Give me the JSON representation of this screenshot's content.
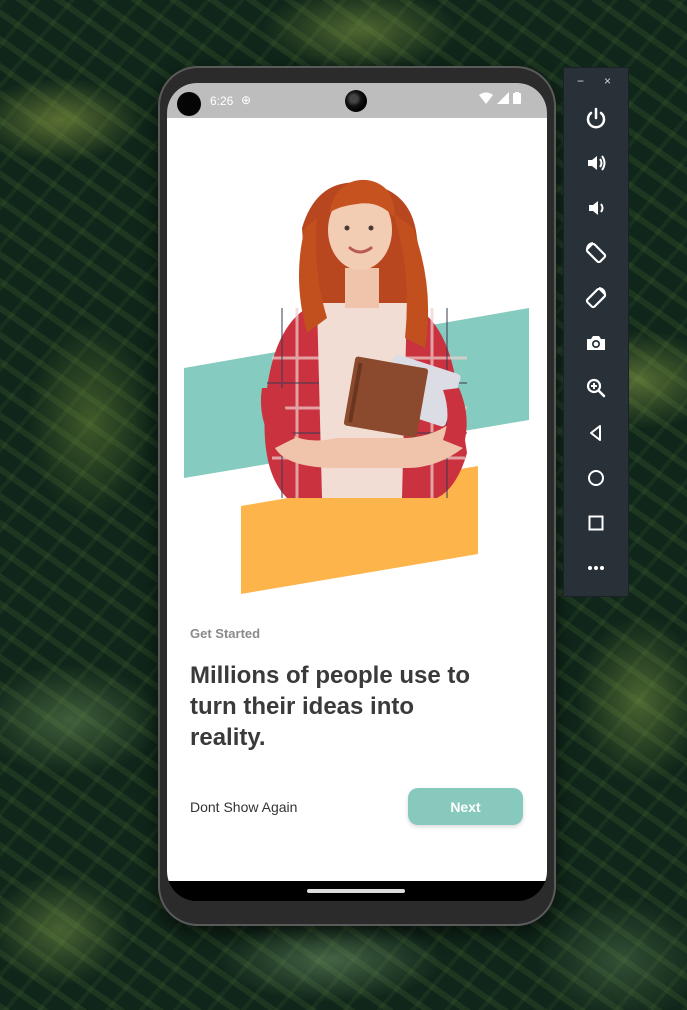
{
  "statusbar": {
    "time": "6:26"
  },
  "onboarding": {
    "label": "Get Started",
    "headline": "Millions of people use to turn their ideas into reality.",
    "dont_show": "Dont Show Again",
    "next": "Next"
  },
  "emulator": {
    "window": {
      "minimize": "−",
      "close": "×"
    },
    "buttons": [
      "power-icon",
      "volume-up-icon",
      "volume-down-icon",
      "rotate-left-icon",
      "rotate-right-icon",
      "camera-icon",
      "zoom-icon",
      "back-icon",
      "home-icon",
      "overview-icon",
      "more-icon"
    ]
  },
  "colors": {
    "accent": "#88c9be",
    "teal_band": "#86cbbf",
    "orange_band": "#fdb54b",
    "headline": "#3a3a3a",
    "label": "#8a8a8a"
  }
}
